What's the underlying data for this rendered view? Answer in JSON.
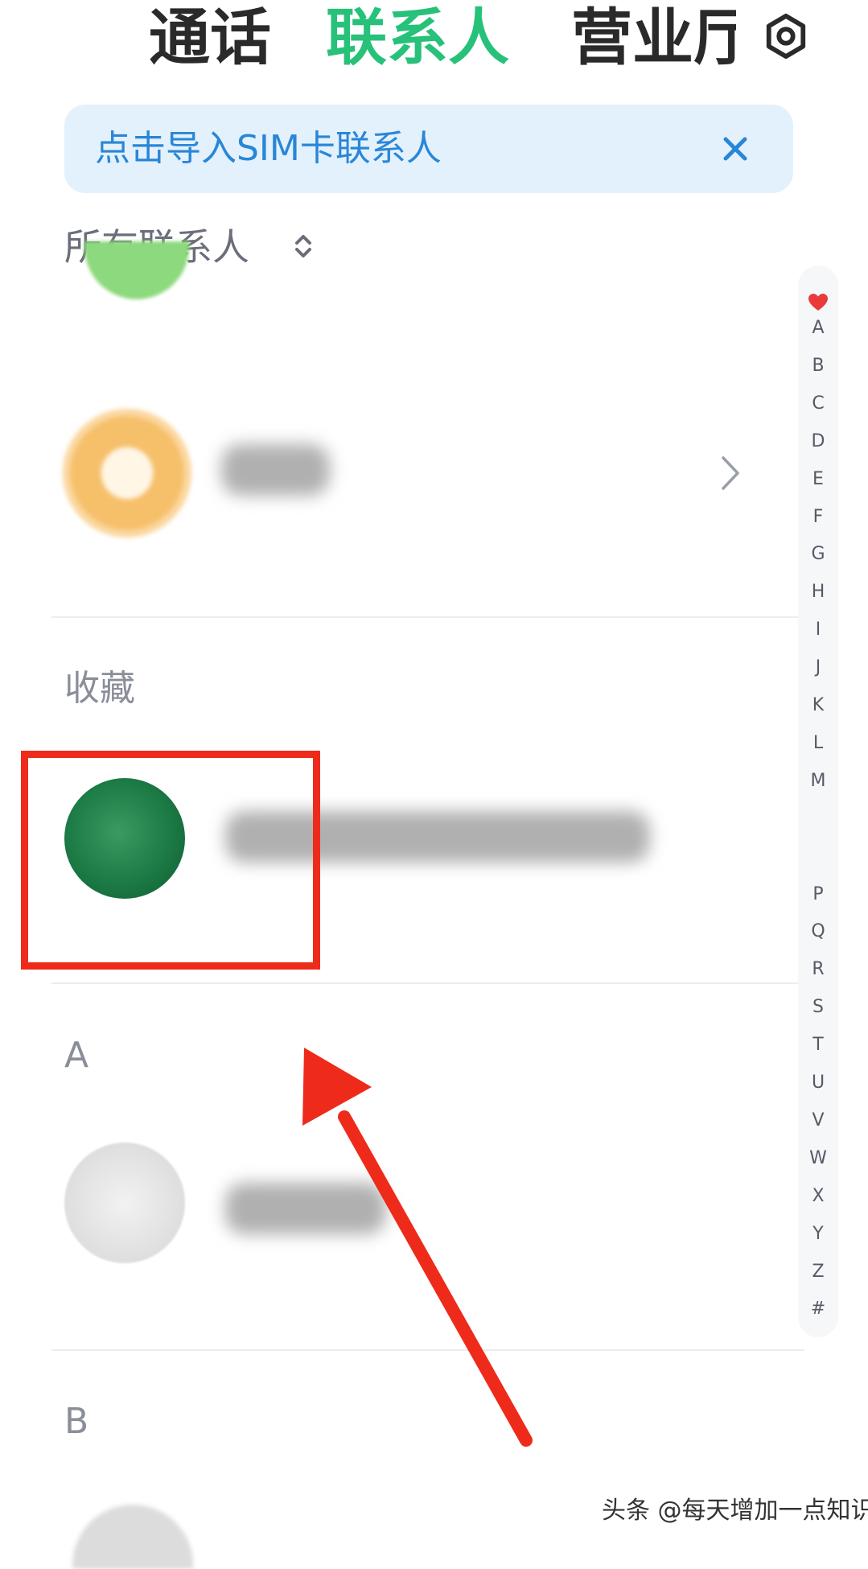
{
  "tabs": [
    {
      "label": "通话",
      "active": false
    },
    {
      "label": "联系人",
      "active": true
    },
    {
      "label": "营业厅",
      "active": false
    }
  ],
  "icons": {
    "settings": "gear-icon",
    "close": "close-icon",
    "sort": "sort-updown-icon",
    "chevron": "chevron-right-icon",
    "favorite": "heart-icon"
  },
  "banner": {
    "text": "点击导入SIM卡联系人"
  },
  "filter": {
    "label": "所有联系人"
  },
  "sections": {
    "favorites": "收藏",
    "a": "A",
    "b": "B"
  },
  "index_bar": {
    "letters": [
      "A",
      "B",
      "C",
      "D",
      "E",
      "F",
      "G",
      "H",
      "I",
      "J",
      "K",
      "L",
      "M",
      "",
      "",
      "P",
      "Q",
      "R",
      "S",
      "T",
      "U",
      "V",
      "W",
      "X",
      "Y",
      "Z",
      "#"
    ]
  },
  "watermark": "头条 @每天增加一点知识",
  "colors": {
    "accent_green": "#27c17a",
    "banner_bg": "#e3f1fc",
    "banner_text": "#2a86d6",
    "annotation_red": "#ee2b1a"
  }
}
